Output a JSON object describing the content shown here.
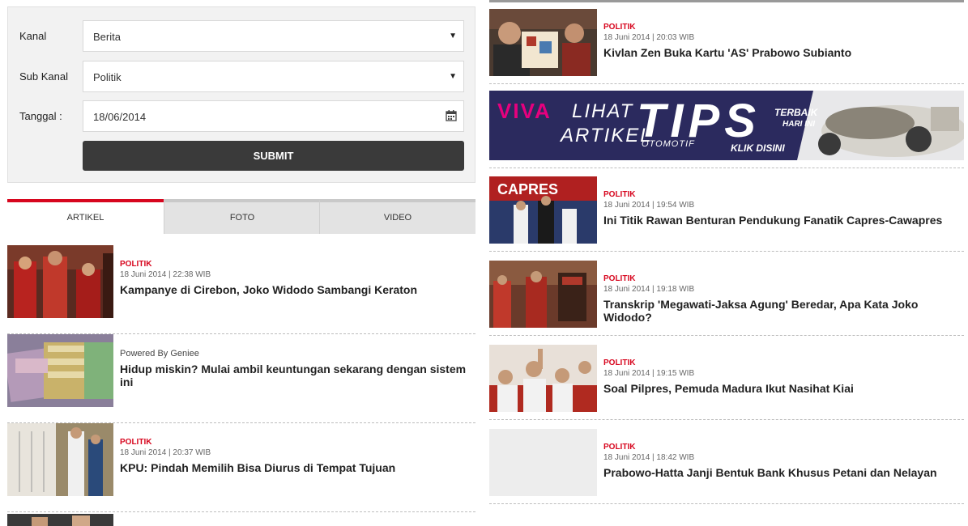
{
  "filter": {
    "kanal_label": "Kanal",
    "kanal_value": "Berita",
    "subkanal_label": "Sub Kanal",
    "subkanal_value": "Politik",
    "tanggal_label": "Tanggal :",
    "tanggal_value": "18/06/2014",
    "submit_label": "SUBMIT"
  },
  "tabs": [
    {
      "label": "ARTIKEL"
    },
    {
      "label": "FOTO"
    },
    {
      "label": "VIDEO"
    }
  ],
  "left_news": [
    {
      "category": "POLITIK",
      "date": "18 Juni 2014 | 22:38 WIB",
      "title": "Kampanye di Cirebon, Joko Widodo Sambangi Keraton"
    },
    {
      "sponsor": "Powered By Geniee",
      "title": "Hidup miskin? Mulai ambil keuntungan sekarang dengan sistem ini"
    },
    {
      "category": "POLITIK",
      "date": "18 Juni 2014 | 20:37 WIB",
      "title": "KPU: Pindah Memilih Bisa Diurus di Tempat Tujuan"
    }
  ],
  "right_news": [
    {
      "category": "POLITIK",
      "date": "18 Juni 2014 | 20:03 WIB",
      "title": "Kivlan Zen Buka Kartu 'AS' Prabowo Subianto"
    },
    {
      "category": "POLITIK",
      "date": "18 Juni 2014 | 19:54 WIB",
      "title": "Ini Titik Rawan Benturan Pendukung Fanatik Capres-Cawapres"
    },
    {
      "category": "POLITIK",
      "date": "18 Juni 2014 | 19:18 WIB",
      "title": "Transkrip 'Megawati-Jaksa Agung' Beredar, Apa Kata Joko Widodo?"
    },
    {
      "category": "POLITIK",
      "date": "18 Juni 2014 | 19:15 WIB",
      "title": "Soal Pilpres, Pemuda Madura Ikut Nasihat Kiai"
    },
    {
      "category": "POLITIK",
      "date": "18 Juni 2014 | 18:42 WIB",
      "title": "Prabowo-Hatta Janji Bentuk Bank Khusus Petani dan Nelayan"
    }
  ],
  "banner": {
    "brand": "VIVA",
    "line1": "LIHAT",
    "line2": "ARTIKEL",
    "big": "TIPS",
    "sub": "OTOMOTIF",
    "side1": "TERBAIK",
    "side2": "HARI INI",
    "cta": "KLIK DISINI"
  },
  "colors": {
    "accent": "#d7061e",
    "button": "#3a3a3a",
    "banner_bg": "#2b2a5e"
  }
}
